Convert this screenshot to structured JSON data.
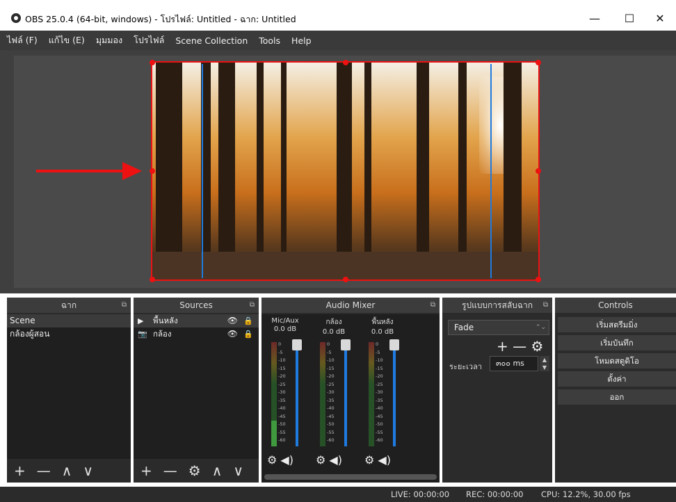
{
  "window": {
    "title": "OBS 25.0.4 (64-bit, windows) - โปรไฟล์: Untitled - ฉาก: Untitled",
    "min_glyph": "—",
    "max_glyph": "☐",
    "close_glyph": "✕"
  },
  "menu": [
    "ไฟล์ (F)",
    "แก้ไข (E)",
    "มุมมอง",
    "โปรไฟล์",
    "Scene Collection",
    "Tools",
    "Help"
  ],
  "colors": {
    "selection_outline": "#e11111",
    "guide_line": "#1f7be0",
    "dock_bg": "#2b2b2b",
    "panel_bg": "#1f1f1f"
  },
  "scenes": {
    "title": "ฉาก",
    "items": [
      "Scene",
      "กล้องผู้สอน"
    ],
    "toolbar": [
      "+",
      "—",
      "∧",
      "∨"
    ]
  },
  "sources": {
    "title": "Sources",
    "items": [
      {
        "label": "พื้นหลัง",
        "icon": "play-icon"
      },
      {
        "label": "กล้อง",
        "icon": "camera-icon"
      }
    ],
    "toolbar": [
      "+",
      "—",
      "⚙",
      "∧",
      "∨"
    ]
  },
  "mixer": {
    "title": "Audio Mixer",
    "scale": [
      "0",
      "-5",
      "-10",
      "-15",
      "-20",
      "-25",
      "-30",
      "-35",
      "-40",
      "-45",
      "-50",
      "-55",
      "-60"
    ],
    "channels": [
      {
        "name": "Mic/Aux",
        "db": "0.0 dB",
        "level": 0.25
      },
      {
        "name": "กล้อง",
        "db": "0.0 dB",
        "level": 0
      },
      {
        "name": "พื้นหลัง",
        "db": "0.0 dB",
        "level": 0
      }
    ],
    "channel_controls": "⚙ ◀)"
  },
  "transitions": {
    "title": "รูปแบบการสลับฉาก",
    "selected": "Fade",
    "tools": "+ — ⚙",
    "duration_label": "ระยะเวลา",
    "duration_value": "๓๐๐ ms"
  },
  "controls": {
    "title": "Controls",
    "buttons": [
      "เริ่มสตรีมมิ่ง",
      "เริ่มบันทึก",
      "โหมดสตูดิโอ",
      "ตั้งค่า",
      "ออก"
    ]
  },
  "status": {
    "live": "LIVE: 00:00:00",
    "rec": "REC: 00:00:00",
    "cpu": "CPU: 12.2%, 30.00 fps"
  }
}
